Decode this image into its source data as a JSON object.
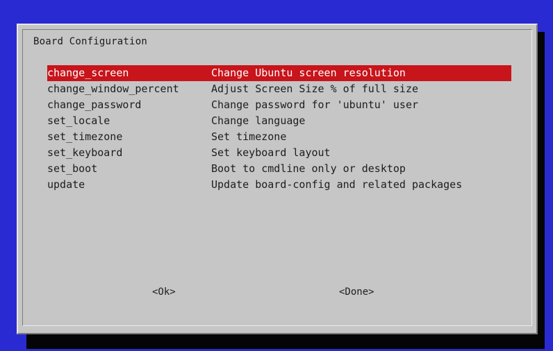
{
  "dialog": {
    "title": "Board Configuration"
  },
  "menu": {
    "items": [
      {
        "tag": "change_screen",
        "desc": "Change Ubuntu screen resolution",
        "selected": true
      },
      {
        "tag": "change_window_percent",
        "desc": "Adjust Screen Size % of full size",
        "selected": false
      },
      {
        "tag": "change_password",
        "desc": "Change password for 'ubuntu' user",
        "selected": false
      },
      {
        "tag": "set_locale",
        "desc": "Change language",
        "selected": false
      },
      {
        "tag": "set_timezone",
        "desc": "Set timezone",
        "selected": false
      },
      {
        "tag": "set_keyboard",
        "desc": "Set keyboard layout",
        "selected": false
      },
      {
        "tag": "set_boot",
        "desc": "Boot to cmdline only or desktop",
        "selected": false
      },
      {
        "tag": "update",
        "desc": "Update board-config and related packages",
        "selected": false
      }
    ]
  },
  "buttons": {
    "ok_label": "<Ok>",
    "done_label": "<Done>"
  },
  "colors": {
    "background": "#2a2ad2",
    "dialog": "#c6c6c6",
    "selection": "#c8141b",
    "shadow": "#050505"
  }
}
